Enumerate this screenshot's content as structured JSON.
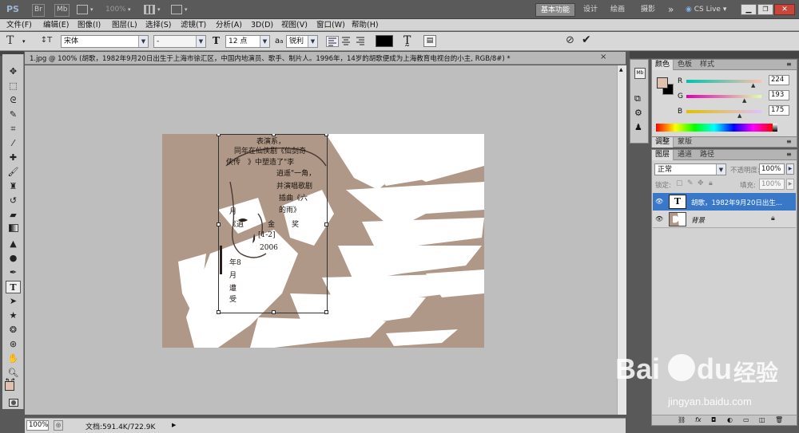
{
  "appbar": {
    "logo": "PS",
    "br_label": "Br",
    "mb_label": "Mb",
    "zoom": "100%",
    "workspaces": [
      "基本功能",
      "设计",
      "绘画",
      "摄影"
    ],
    "active_workspace": "基本功能",
    "more": "»",
    "cslive": "CS Live"
  },
  "menubar": {
    "items": [
      "文件(F)",
      "编辑(E)",
      "图像(I)",
      "图层(L)",
      "选择(S)",
      "滤镜(T)",
      "分析(A)",
      "3D(D)",
      "视图(V)",
      "窗口(W)",
      "帮助(H)"
    ]
  },
  "options": {
    "tool_glyph": "T",
    "font_family": "宋体",
    "font_style": "-",
    "font_size": "12 点",
    "aa_label": "a",
    "aa_sub": "a",
    "antialias": "锐利",
    "text_color": "#000000"
  },
  "document": {
    "tab_title": "1.jpg @ 100% (胡歌，1982年9月20日出生于上海市徐汇区，中国内地演员、歌手、制片人。1996年，14岁的胡歌便成为上海教育电视台的小主, RGB/8#) *",
    "close_x": "×",
    "bg_color": "#b09888",
    "text_lines": [
      "表演系，",
      "同年在仙侠剧《仙剑奇",
      "侠传　》中塑造了\"李",
      "逍遥\"一角，",
      "并演唱歌剧",
      "插曲《六",
      "的雨》",
      "月",
      "《逍",
      "金",
      "奖",
      "[1-2]",
      "2006",
      "年8",
      "月",
      "遭",
      "受"
    ]
  },
  "status": {
    "zoom": "100%",
    "doc_info": "文档:591.4K/722.9K"
  },
  "color_panel": {
    "tabs": [
      "颜色",
      "色板",
      "样式"
    ],
    "active_tab": "颜色",
    "channels": [
      {
        "label": "R",
        "value": "224"
      },
      {
        "label": "G",
        "value": "193"
      },
      {
        "label": "B",
        "value": "175"
      }
    ],
    "fg_color": "#e0c1af",
    "bg_color": "#000000"
  },
  "adjust_panel": {
    "tabs": [
      "调整",
      "蒙版"
    ]
  },
  "layers_panel": {
    "tabs": [
      "图层",
      "通道",
      "路径"
    ],
    "active_tab": "图层",
    "blend_mode": "正常",
    "opacity_label": "不透明度:",
    "opacity": "100%",
    "lock_label": "锁定:",
    "fill_label": "填充:",
    "fill": "100%",
    "layers": [
      {
        "name": "胡歌，1982年9月20日出生...",
        "thumb": "T",
        "selected": true
      },
      {
        "name": "背景",
        "thumb": "",
        "selected": false
      }
    ]
  },
  "watermark": {
    "brand": "Bai",
    "brand2": "du",
    "cn": "经验",
    "url": "jingyan.baidu.com"
  }
}
